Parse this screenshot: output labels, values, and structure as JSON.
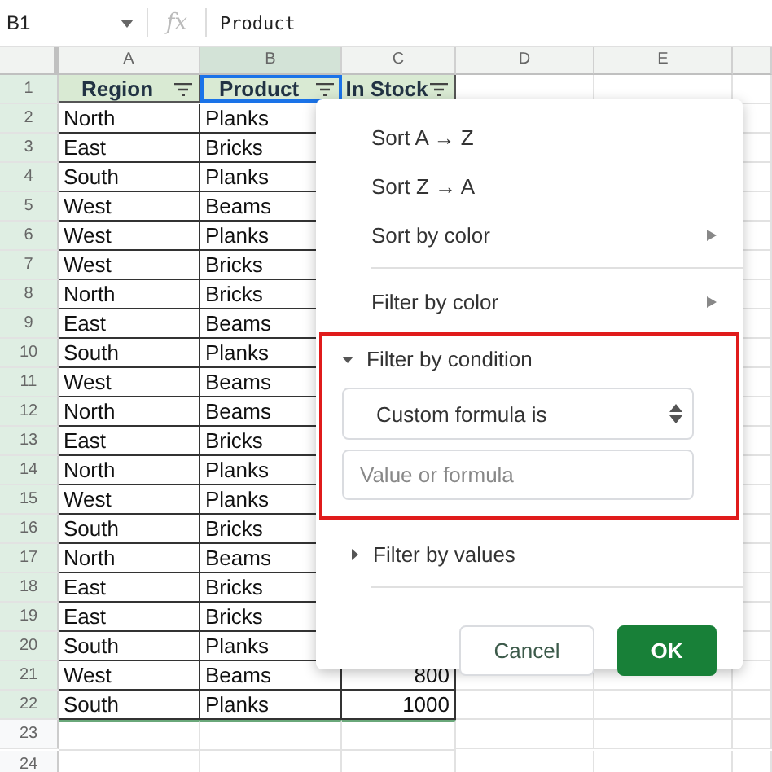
{
  "formula_bar": {
    "cell_ref": "B1",
    "fx": "fx",
    "value": "Product"
  },
  "columns": [
    {
      "label": "A",
      "selected": false
    },
    {
      "label": "B",
      "selected": true
    },
    {
      "label": "C",
      "selected": false
    },
    {
      "label": "D",
      "selected": false
    },
    {
      "label": "E",
      "selected": false
    }
  ],
  "header_row_number": "1",
  "headers": [
    {
      "label": "Region",
      "filter": true
    },
    {
      "label": "Product",
      "filter": true,
      "selected": true
    },
    {
      "label": "In Stock",
      "filter": true
    }
  ],
  "rows": [
    {
      "number": "2",
      "cells": [
        "North",
        "Planks",
        ""
      ]
    },
    {
      "number": "3",
      "cells": [
        "East",
        "Bricks",
        ""
      ]
    },
    {
      "number": "4",
      "cells": [
        "South",
        "Planks",
        ""
      ]
    },
    {
      "number": "5",
      "cells": [
        "West",
        "Beams",
        ""
      ]
    },
    {
      "number": "6",
      "cells": [
        "West",
        "Planks",
        ""
      ]
    },
    {
      "number": "7",
      "cells": [
        "West",
        "Bricks",
        ""
      ]
    },
    {
      "number": "8",
      "cells": [
        "North",
        "Bricks",
        ""
      ]
    },
    {
      "number": "9",
      "cells": [
        "East",
        "Beams",
        ""
      ]
    },
    {
      "number": "10",
      "cells": [
        "South",
        "Planks",
        ""
      ]
    },
    {
      "number": "11",
      "cells": [
        "West",
        "Beams",
        ""
      ]
    },
    {
      "number": "12",
      "cells": [
        "North",
        "Beams",
        ""
      ]
    },
    {
      "number": "13",
      "cells": [
        "East",
        "Bricks",
        ""
      ]
    },
    {
      "number": "14",
      "cells": [
        "North",
        "Planks",
        ""
      ]
    },
    {
      "number": "15",
      "cells": [
        "West",
        "Planks",
        ""
      ]
    },
    {
      "number": "16",
      "cells": [
        "South",
        "Bricks",
        ""
      ]
    },
    {
      "number": "17",
      "cells": [
        "North",
        "Beams",
        ""
      ]
    },
    {
      "number": "18",
      "cells": [
        "East",
        "Bricks",
        ""
      ]
    },
    {
      "number": "19",
      "cells": [
        "East",
        "Bricks",
        ""
      ]
    },
    {
      "number": "20",
      "cells": [
        "South",
        "Planks",
        ""
      ]
    },
    {
      "number": "21",
      "cells": [
        "West",
        "Beams",
        "800"
      ]
    },
    {
      "number": "22",
      "cells": [
        "South",
        "Planks",
        "1000"
      ]
    }
  ],
  "empty_rows": [
    "23",
    "24"
  ],
  "menu": {
    "items": [
      {
        "kind": "item",
        "label": "Sort A → Z"
      },
      {
        "kind": "item",
        "label": "Sort Z → A"
      },
      {
        "kind": "submenu",
        "label": "Sort by color"
      },
      {
        "kind": "divider"
      },
      {
        "kind": "submenu",
        "label": "Filter by color"
      }
    ],
    "condition": {
      "label": "Filter by condition",
      "expanded": true,
      "select": "Custom formula is",
      "placeholder": "Value or formula",
      "highlighted": true
    },
    "values_section": {
      "label": "Filter by values",
      "expanded": false
    },
    "buttons": [
      {
        "kind": "secondary",
        "label": "Cancel"
      },
      {
        "kind": "primary",
        "label": "OK"
      }
    ]
  }
}
